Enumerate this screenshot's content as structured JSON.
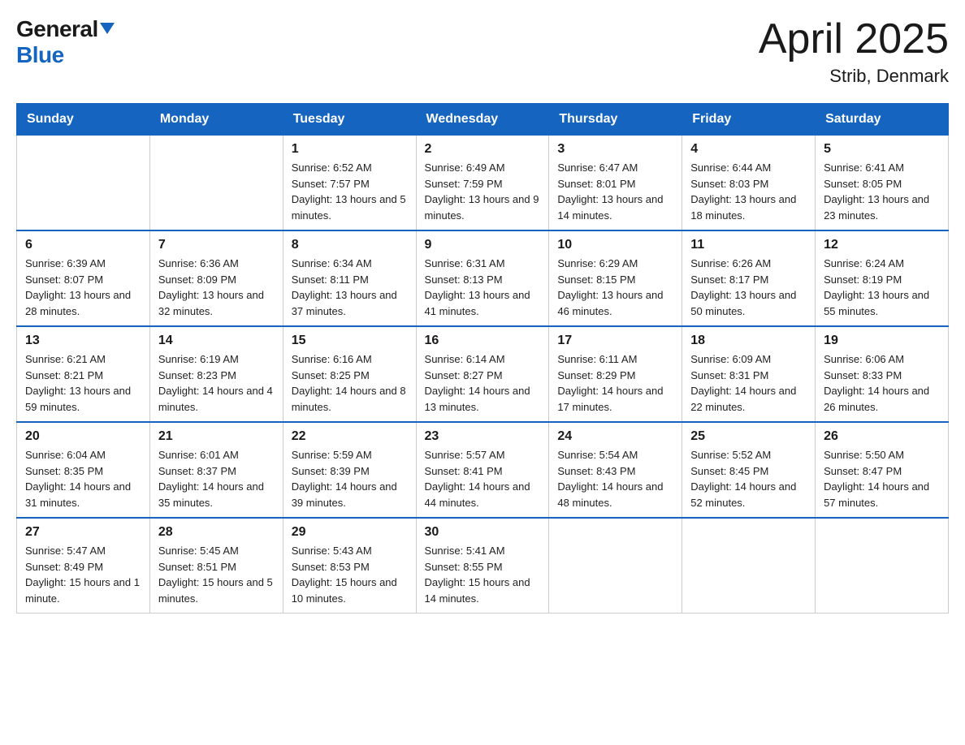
{
  "logo": {
    "general": "General",
    "blue": "Blue",
    "triangle_label": "logo-triangle"
  },
  "title": "April 2025",
  "subtitle": "Strib, Denmark",
  "headers": [
    "Sunday",
    "Monday",
    "Tuesday",
    "Wednesday",
    "Thursday",
    "Friday",
    "Saturday"
  ],
  "weeks": [
    [
      {
        "day": "",
        "sunrise": "",
        "sunset": "",
        "daylight": ""
      },
      {
        "day": "",
        "sunrise": "",
        "sunset": "",
        "daylight": ""
      },
      {
        "day": "1",
        "sunrise": "Sunrise: 6:52 AM",
        "sunset": "Sunset: 7:57 PM",
        "daylight": "Daylight: 13 hours and 5 minutes."
      },
      {
        "day": "2",
        "sunrise": "Sunrise: 6:49 AM",
        "sunset": "Sunset: 7:59 PM",
        "daylight": "Daylight: 13 hours and 9 minutes."
      },
      {
        "day": "3",
        "sunrise": "Sunrise: 6:47 AM",
        "sunset": "Sunset: 8:01 PM",
        "daylight": "Daylight: 13 hours and 14 minutes."
      },
      {
        "day": "4",
        "sunrise": "Sunrise: 6:44 AM",
        "sunset": "Sunset: 8:03 PM",
        "daylight": "Daylight: 13 hours and 18 minutes."
      },
      {
        "day": "5",
        "sunrise": "Sunrise: 6:41 AM",
        "sunset": "Sunset: 8:05 PM",
        "daylight": "Daylight: 13 hours and 23 minutes."
      }
    ],
    [
      {
        "day": "6",
        "sunrise": "Sunrise: 6:39 AM",
        "sunset": "Sunset: 8:07 PM",
        "daylight": "Daylight: 13 hours and 28 minutes."
      },
      {
        "day": "7",
        "sunrise": "Sunrise: 6:36 AM",
        "sunset": "Sunset: 8:09 PM",
        "daylight": "Daylight: 13 hours and 32 minutes."
      },
      {
        "day": "8",
        "sunrise": "Sunrise: 6:34 AM",
        "sunset": "Sunset: 8:11 PM",
        "daylight": "Daylight: 13 hours and 37 minutes."
      },
      {
        "day": "9",
        "sunrise": "Sunrise: 6:31 AM",
        "sunset": "Sunset: 8:13 PM",
        "daylight": "Daylight: 13 hours and 41 minutes."
      },
      {
        "day": "10",
        "sunrise": "Sunrise: 6:29 AM",
        "sunset": "Sunset: 8:15 PM",
        "daylight": "Daylight: 13 hours and 46 minutes."
      },
      {
        "day": "11",
        "sunrise": "Sunrise: 6:26 AM",
        "sunset": "Sunset: 8:17 PM",
        "daylight": "Daylight: 13 hours and 50 minutes."
      },
      {
        "day": "12",
        "sunrise": "Sunrise: 6:24 AM",
        "sunset": "Sunset: 8:19 PM",
        "daylight": "Daylight: 13 hours and 55 minutes."
      }
    ],
    [
      {
        "day": "13",
        "sunrise": "Sunrise: 6:21 AM",
        "sunset": "Sunset: 8:21 PM",
        "daylight": "Daylight: 13 hours and 59 minutes."
      },
      {
        "day": "14",
        "sunrise": "Sunrise: 6:19 AM",
        "sunset": "Sunset: 8:23 PM",
        "daylight": "Daylight: 14 hours and 4 minutes."
      },
      {
        "day": "15",
        "sunrise": "Sunrise: 6:16 AM",
        "sunset": "Sunset: 8:25 PM",
        "daylight": "Daylight: 14 hours and 8 minutes."
      },
      {
        "day": "16",
        "sunrise": "Sunrise: 6:14 AM",
        "sunset": "Sunset: 8:27 PM",
        "daylight": "Daylight: 14 hours and 13 minutes."
      },
      {
        "day": "17",
        "sunrise": "Sunrise: 6:11 AM",
        "sunset": "Sunset: 8:29 PM",
        "daylight": "Daylight: 14 hours and 17 minutes."
      },
      {
        "day": "18",
        "sunrise": "Sunrise: 6:09 AM",
        "sunset": "Sunset: 8:31 PM",
        "daylight": "Daylight: 14 hours and 22 minutes."
      },
      {
        "day": "19",
        "sunrise": "Sunrise: 6:06 AM",
        "sunset": "Sunset: 8:33 PM",
        "daylight": "Daylight: 14 hours and 26 minutes."
      }
    ],
    [
      {
        "day": "20",
        "sunrise": "Sunrise: 6:04 AM",
        "sunset": "Sunset: 8:35 PM",
        "daylight": "Daylight: 14 hours and 31 minutes."
      },
      {
        "day": "21",
        "sunrise": "Sunrise: 6:01 AM",
        "sunset": "Sunset: 8:37 PM",
        "daylight": "Daylight: 14 hours and 35 minutes."
      },
      {
        "day": "22",
        "sunrise": "Sunrise: 5:59 AM",
        "sunset": "Sunset: 8:39 PM",
        "daylight": "Daylight: 14 hours and 39 minutes."
      },
      {
        "day": "23",
        "sunrise": "Sunrise: 5:57 AM",
        "sunset": "Sunset: 8:41 PM",
        "daylight": "Daylight: 14 hours and 44 minutes."
      },
      {
        "day": "24",
        "sunrise": "Sunrise: 5:54 AM",
        "sunset": "Sunset: 8:43 PM",
        "daylight": "Daylight: 14 hours and 48 minutes."
      },
      {
        "day": "25",
        "sunrise": "Sunrise: 5:52 AM",
        "sunset": "Sunset: 8:45 PM",
        "daylight": "Daylight: 14 hours and 52 minutes."
      },
      {
        "day": "26",
        "sunrise": "Sunrise: 5:50 AM",
        "sunset": "Sunset: 8:47 PM",
        "daylight": "Daylight: 14 hours and 57 minutes."
      }
    ],
    [
      {
        "day": "27",
        "sunrise": "Sunrise: 5:47 AM",
        "sunset": "Sunset: 8:49 PM",
        "daylight": "Daylight: 15 hours and 1 minute."
      },
      {
        "day": "28",
        "sunrise": "Sunrise: 5:45 AM",
        "sunset": "Sunset: 8:51 PM",
        "daylight": "Daylight: 15 hours and 5 minutes."
      },
      {
        "day": "29",
        "sunrise": "Sunrise: 5:43 AM",
        "sunset": "Sunset: 8:53 PM",
        "daylight": "Daylight: 15 hours and 10 minutes."
      },
      {
        "day": "30",
        "sunrise": "Sunrise: 5:41 AM",
        "sunset": "Sunset: 8:55 PM",
        "daylight": "Daylight: 15 hours and 14 minutes."
      },
      {
        "day": "",
        "sunrise": "",
        "sunset": "",
        "daylight": ""
      },
      {
        "day": "",
        "sunrise": "",
        "sunset": "",
        "daylight": ""
      },
      {
        "day": "",
        "sunrise": "",
        "sunset": "",
        "daylight": ""
      }
    ]
  ]
}
